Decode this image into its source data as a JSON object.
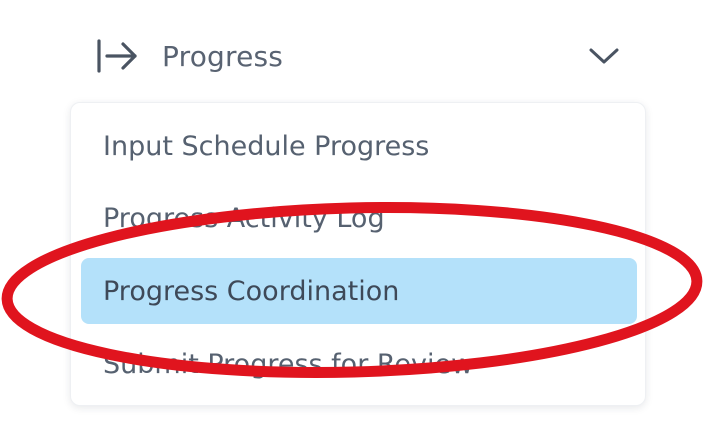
{
  "header": {
    "title": "Progress",
    "icon": "arrow-right-to-line-icon",
    "chevron": "chevron-down-icon"
  },
  "menu": {
    "items": [
      {
        "label": "Input Schedule Progress",
        "active": false
      },
      {
        "label": "Progress Activity Log",
        "active": false
      },
      {
        "label": "Progress Coordination",
        "active": true
      },
      {
        "label": "Submit Progress for Review",
        "active": false
      }
    ]
  },
  "colors": {
    "text": "#566170",
    "highlight": "#b4e1fa",
    "annotation": "#e0141e"
  }
}
